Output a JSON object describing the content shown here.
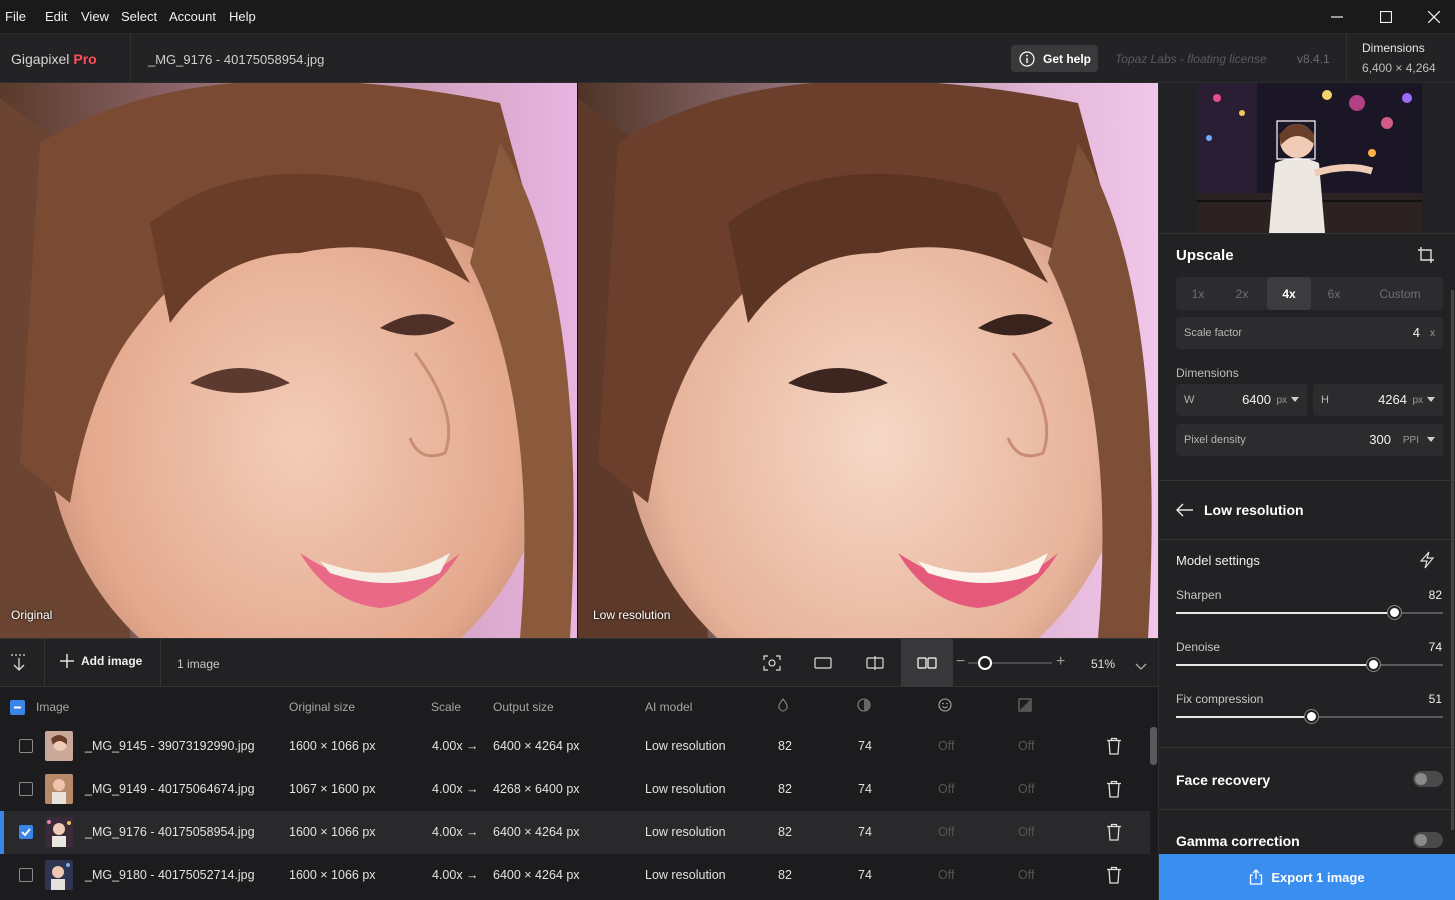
{
  "menu": {
    "items": [
      "File",
      "Edit",
      "View",
      "Select",
      "Account",
      "Help"
    ]
  },
  "window_controls": {
    "minimize": "─",
    "maximize": "☐",
    "close": "✕"
  },
  "header": {
    "app_name": "Gigapixel",
    "app_edition": "Pro",
    "file_name": "_MG_9176 - 40175058954.jpg",
    "get_help": "Get help",
    "license": "Topaz Labs - floating license",
    "version": "v8.4.1",
    "dimensions_label": "Dimensions",
    "dimensions_value": "6,400 × 4,264"
  },
  "preview": {
    "left_label": "Original",
    "right_label": "Low resolution"
  },
  "toolbar": {
    "add_image": "Add image",
    "image_count": "1 image",
    "zoom": "51%",
    "zoom_level": 0.2
  },
  "table": {
    "headers": [
      "Image",
      "Original size",
      "Scale",
      "Output size",
      "AI model"
    ],
    "header_icons": [
      "sharpen-icon",
      "denoise-icon",
      "face-icon",
      "gamma-icon"
    ],
    "rows": [
      {
        "name": "_MG_9145 - 39073192990.jpg",
        "original": "1600 × 1066 px",
        "scale": "4.00x →",
        "output": "6400 × 4264 px",
        "model": "Low resolution",
        "sharpen": "82",
        "denoise": "74",
        "face": "Off",
        "gamma": "Off",
        "checked": false
      },
      {
        "name": "_MG_9149 - 40175064674.jpg",
        "original": "1067 × 1600 px",
        "scale": "4.00x →",
        "output": "4268 × 6400 px",
        "model": "Low resolution",
        "sharpen": "82",
        "denoise": "74",
        "face": "Off",
        "gamma": "Off",
        "checked": false
      },
      {
        "name": "_MG_9176 - 40175058954.jpg",
        "original": "1600 × 1066 px",
        "scale": "4.00x →",
        "output": "6400 × 4264 px",
        "model": "Low resolution",
        "sharpen": "82",
        "denoise": "74",
        "face": "Off",
        "gamma": "Off",
        "checked": true
      },
      {
        "name": "_MG_9180 - 40175052714.jpg",
        "original": "1600 × 1066 px",
        "scale": "4.00x →",
        "output": "6400 × 4264 px",
        "model": "Low resolution",
        "sharpen": "82",
        "denoise": "74",
        "face": "Off",
        "gamma": "Off",
        "checked": false
      }
    ]
  },
  "upscale": {
    "title": "Upscale",
    "scale_options": [
      "1x",
      "2x",
      "4x",
      "6x",
      "Custom"
    ],
    "active_scale": "4x",
    "scale_factor_label": "Scale factor",
    "scale_factor_value": "4",
    "scale_factor_unit": "x",
    "dimensions_label": "Dimensions",
    "width_label": "W",
    "width_value": "6400",
    "height_label": "H",
    "height_value": "4264",
    "px_unit": "px",
    "pixel_density_label": "Pixel density",
    "pixel_density_value": "300",
    "ppi_unit": "PPI"
  },
  "model": {
    "back_title": "Low resolution",
    "settings_title": "Model settings",
    "sliders": [
      {
        "label": "Sharpen",
        "value": "82",
        "fraction": 0.82
      },
      {
        "label": "Denoise",
        "value": "74",
        "fraction": 0.74
      },
      {
        "label": "Fix compression",
        "value": "51",
        "fraction": 0.51
      }
    ],
    "face_recovery": "Face recovery",
    "gamma_correction": "Gamma correction"
  },
  "export": {
    "label": "Export 1 image"
  },
  "colors": {
    "accent": "#3a8ef0",
    "brand": "#ff4d5e"
  }
}
